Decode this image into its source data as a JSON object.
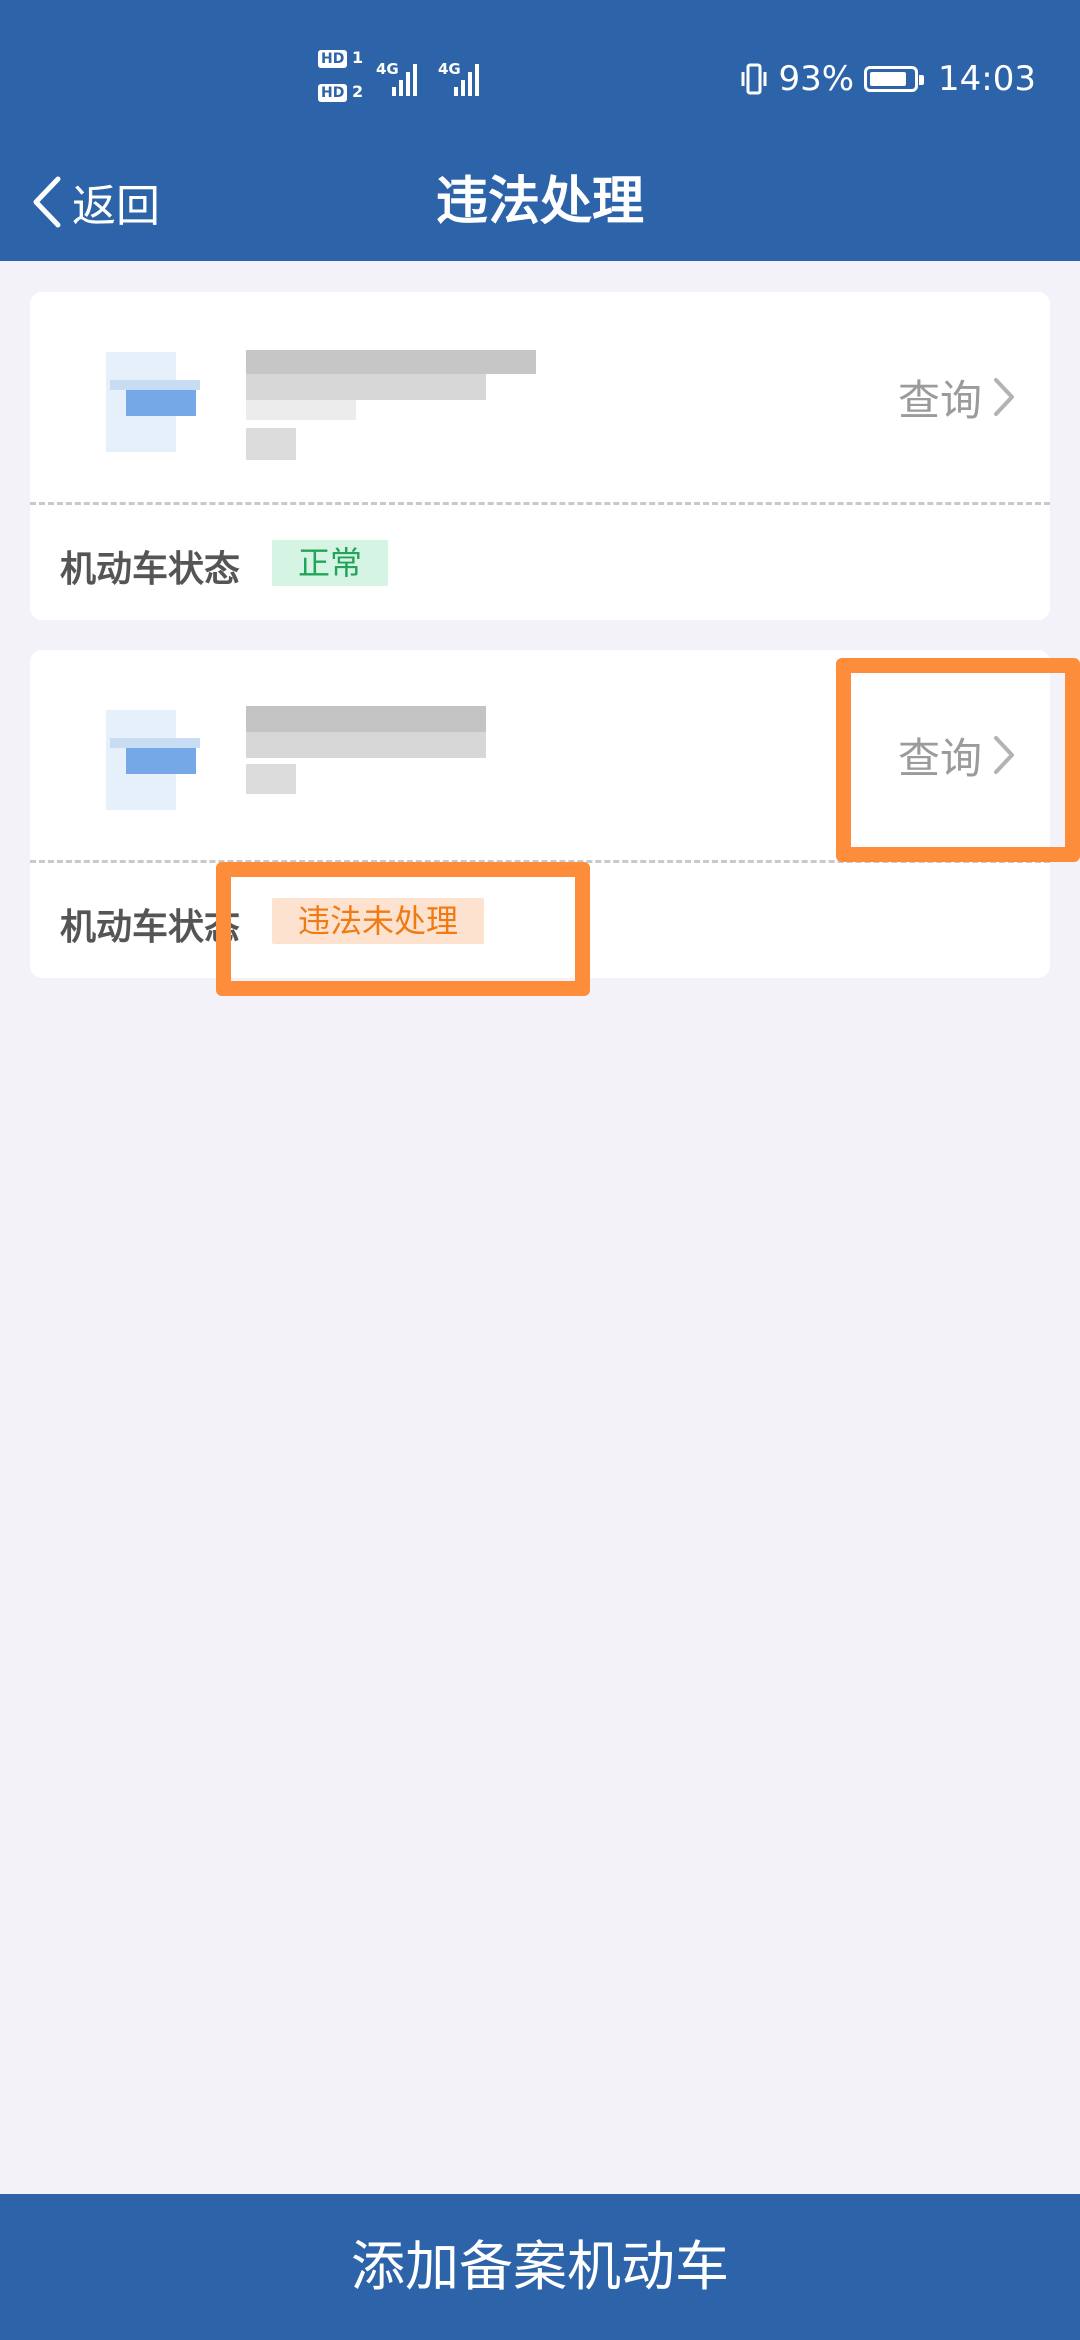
{
  "status_bar": {
    "sim1_badge": "HD",
    "sim1_num": "1",
    "sim2_badge": "HD",
    "sim2_num": "2",
    "network1": "4G",
    "network2": "4G",
    "battery_percent": "93%",
    "battery_level": 0.93,
    "time": "14:03",
    "icons": [
      "vibrate-icon",
      "signal-icon",
      "battery-icon"
    ]
  },
  "nav": {
    "back_label": "返回",
    "title": "违法处理"
  },
  "vehicles": [
    {
      "query_label": "查询",
      "status_label": "机动车状态",
      "status_value": "正常",
      "status_color": "#22a45a"
    },
    {
      "query_label": "查询",
      "status_label": "机动车状态",
      "status_value": "违法未处理",
      "status_color": "#f07a14"
    }
  ],
  "bottom_button": {
    "label": "添加备案机动车"
  },
  "colors": {
    "primary": "#2d64a9",
    "background": "#f3f2f8",
    "highlight": "#fd8c3b"
  }
}
